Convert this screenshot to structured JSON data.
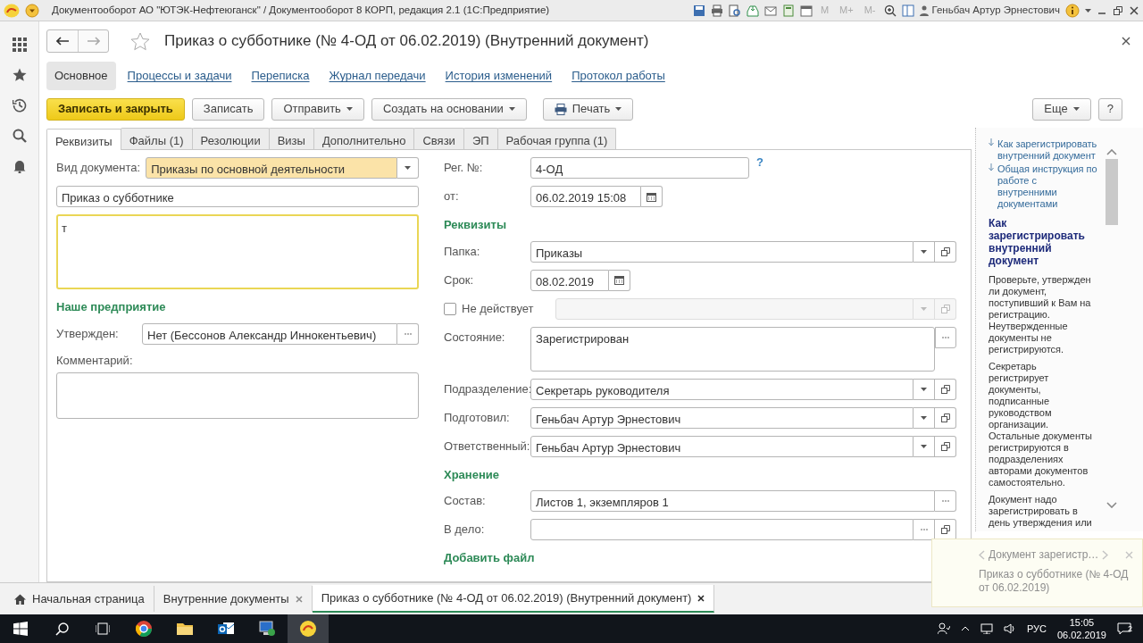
{
  "window": {
    "title": "Документооборот АО \"ЮТЭК-Нефтеюганск\" / Документооборот 8 КОРП, редакция 2.1 (1С:Предприятие)",
    "memory_buttons": [
      {
        "label": "M",
        "disabled": true
      },
      {
        "label": "M+",
        "disabled": true
      },
      {
        "label": "M-",
        "disabled": true
      }
    ],
    "user": "Геньбач Артур Эрнестович"
  },
  "document": {
    "title": "Приказ о субботнике (№ 4-ОД от 06.02.2019) (Внутренний документ)",
    "favorite": false
  },
  "sections": [
    {
      "label": "Основное",
      "selected": true
    },
    {
      "label": "Процессы и задачи",
      "selected": false
    },
    {
      "label": "Переписка",
      "selected": false
    },
    {
      "label": "Журнал передачи",
      "selected": false
    },
    {
      "label": "История изменений",
      "selected": false
    },
    {
      "label": "Протокол работы",
      "selected": false
    }
  ],
  "commands": [
    {
      "label": "Записать и закрыть",
      "kind": "primary"
    },
    {
      "label": "Записать",
      "kind": "plain"
    },
    {
      "label": "Отправить",
      "kind": "menu"
    },
    {
      "label": "Создать на основании",
      "kind": "menu"
    },
    {
      "label": "Печать",
      "kind": "print"
    }
  ],
  "more_button": "Еще",
  "help_button": "?",
  "tabs": [
    {
      "label": "Реквизиты",
      "selected": true
    },
    {
      "label": "Файлы (1)",
      "selected": false
    },
    {
      "label": "Резолюции",
      "selected": false
    },
    {
      "label": "Визы",
      "selected": false
    },
    {
      "label": "Дополнительно",
      "selected": false
    },
    {
      "label": "Связи",
      "selected": false
    },
    {
      "label": "ЭП",
      "selected": false
    },
    {
      "label": "Рабочая группа (1)",
      "selected": false
    }
  ],
  "left_fields": [
    {
      "kind": "select",
      "label": "Вид документа:",
      "value": "Приказы по основной деятельности",
      "highlighted": true
    },
    {
      "kind": "text",
      "value": "Приказ о субботнике"
    },
    {
      "kind": "memo",
      "value": "т",
      "focused": true
    },
    {
      "kind": "heading",
      "label": "Наше предприятие"
    },
    {
      "kind": "choice",
      "label": "Утвержден:",
      "value": "Нет (Бессонов Александр Иннокентьевич)"
    },
    {
      "kind": "comment",
      "label": "Комментарий:"
    }
  ],
  "right_fields": [
    {
      "kind": "text",
      "label": "Рег. №:",
      "value": "4-ОД",
      "hint": "?"
    },
    {
      "kind": "date",
      "label": "от:",
      "value": "06.02.2019 15:08"
    },
    {
      "kind": "heading",
      "label": "Реквизиты"
    },
    {
      "kind": "ref",
      "label": "Папка:",
      "value": "Приказы"
    },
    {
      "kind": "date",
      "label": "Срок:",
      "value": "08.02.2019"
    },
    {
      "kind": "check_ref",
      "label": "Не действует",
      "checked": false,
      "disabled": true
    },
    {
      "kind": "memo_choice",
      "label": "Состояние:",
      "value": "Зарегистрирован"
    },
    {
      "kind": "ref",
      "label": "Подразделение:",
      "value": "Секретарь руководителя"
    },
    {
      "kind": "ref",
      "label": "Подготовил:",
      "value": "Геньбач Артур Эрнестович"
    },
    {
      "kind": "ref",
      "label": "Ответственный:",
      "value": "Геньбач Артур Эрнестович"
    },
    {
      "kind": "heading",
      "label": "Хранение"
    },
    {
      "kind": "choice",
      "label": "Состав:",
      "value": "Листов 1, экземпляров 1"
    },
    {
      "kind": "choice_ref",
      "label": "В дело:"
    },
    {
      "kind": "heading",
      "label": "Добавить файл"
    }
  ],
  "help": {
    "links": [
      "Как зарегистрировать внутренний документ",
      "Общая инструкция по работе с внутренними документами"
    ],
    "heading": "Как зарегистрировать внутренний документ",
    "paragraphs": [
      "Проверьте, утвержден ли документ, поступивший к Вам на регистрацию. Неутвержденные документы не регистрируются.",
      "Секретарь регистрирует документы, подписанные руководством организации. Остальные документы регистрируются в подразделениях авторами документов самостоятельно.",
      "Документ надо зарегистрировать в день утверждения или"
    ]
  },
  "open_windows": [
    {
      "kind": "home",
      "label": "Начальная страница",
      "selected": false
    },
    {
      "kind": "window",
      "label": "Внутренние документы",
      "selected": false
    },
    {
      "kind": "window",
      "label": "Приказ о субботнике (№ 4-ОД от 06.02.2019) (Внутренний документ)",
      "selected": true
    }
  ],
  "notification": {
    "title": "Документ зарегистр…",
    "text": "Приказ о субботнике (№ 4-ОД от 06.02.2019)"
  },
  "taskbar": {
    "apps": [
      {
        "kind": "browser",
        "active": false
      },
      {
        "kind": "folder",
        "active": false
      },
      {
        "kind": "mail",
        "active": false
      },
      {
        "kind": "computer",
        "active": false
      },
      {
        "kind": "onec",
        "active": true
      }
    ],
    "language": "РУС",
    "time": "15:05",
    "date": "06.02.2019",
    "notifications": "2"
  }
}
